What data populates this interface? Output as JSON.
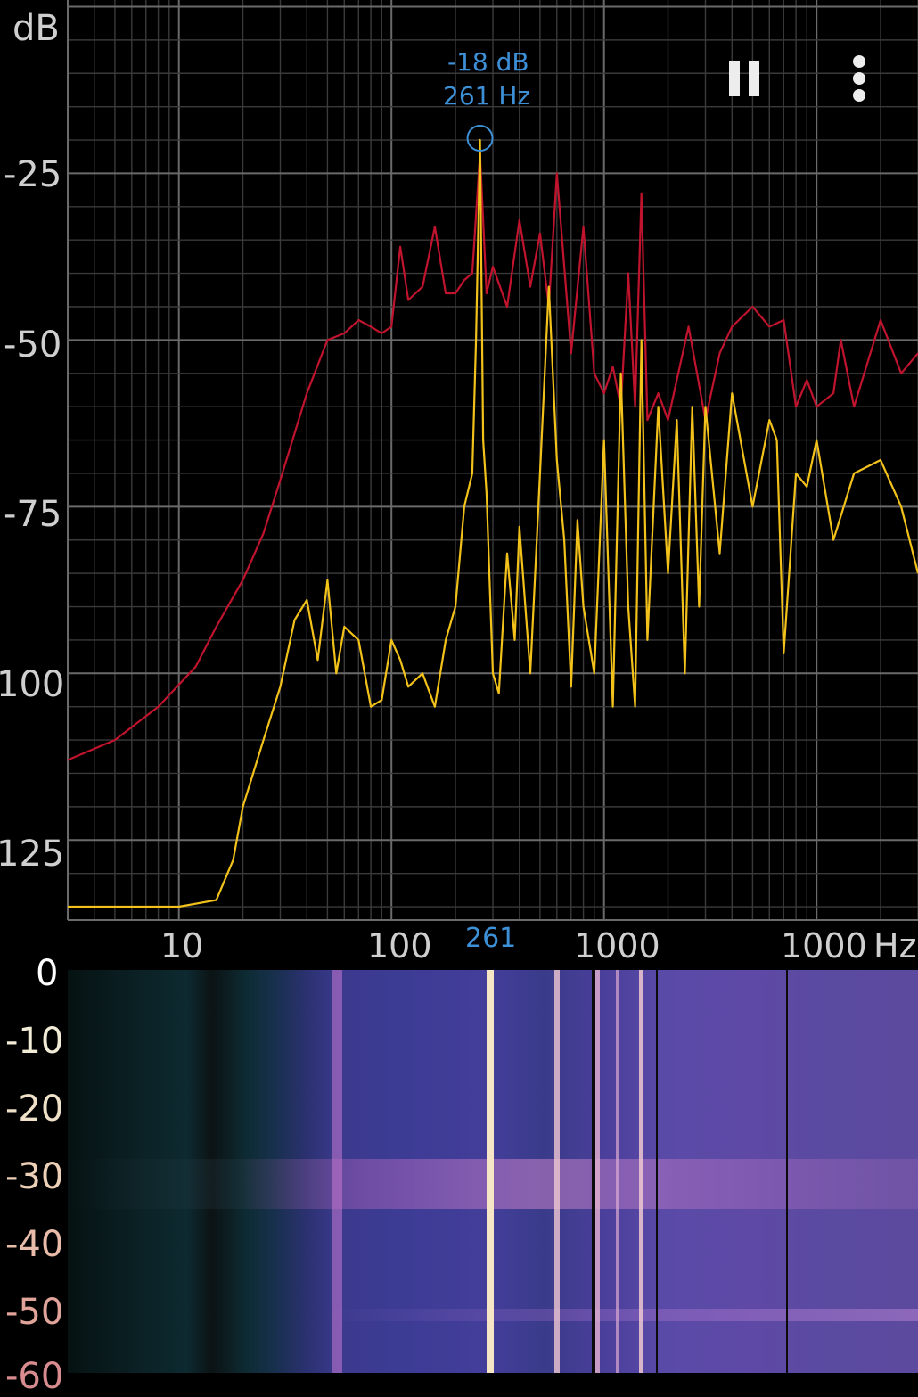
{
  "colors": {
    "background": "#000000",
    "grid": "#6a6a6a",
    "grid_minor": "#3a3a3a",
    "peak_hold": "#c0142e",
    "current": "#f2c21b",
    "peak_marker": "#3d8fd6",
    "axis_text": "#cfcfcf"
  },
  "toolbar": {
    "pause_icon": "pause-icon",
    "more_icon": "more-vertical-icon"
  },
  "spectrum": {
    "y_unit": "dB",
    "y_ticks": [
      "-25",
      "-50",
      "-75",
      "100",
      "125"
    ],
    "x_ticks": [
      "10",
      "100",
      "1000",
      "1000"
    ],
    "x_unit": "Hz",
    "x_marker_label": "261",
    "peak": {
      "level_label": "-18 dB",
      "freq_label": "261 Hz"
    }
  },
  "spectrogram": {
    "time_ticks": [
      "0",
      "-10",
      "-20",
      "-30",
      "-40",
      "-50",
      "-60"
    ],
    "time_tick_colors": [
      "#ffffff",
      "#f2ecd6",
      "#efe1c8",
      "#ecd0b8",
      "#e8bca8",
      "#e0a49a",
      "#d88c90"
    ]
  },
  "chart_data": {
    "type": "line",
    "x_scale": "log",
    "xlim": [
      3,
      30000
    ],
    "ylim": [
      -137,
      1
    ],
    "series": [
      {
        "x": [
          3,
          5,
          8,
          12,
          15,
          20,
          25,
          30,
          40,
          50,
          60,
          70,
          80,
          90,
          100,
          110,
          120,
          140,
          160,
          180,
          200,
          220,
          240,
          261,
          280,
          300,
          350,
          400,
          450,
          500,
          550,
          600,
          700,
          800,
          900,
          1000,
          1100,
          1200,
          1300,
          1400,
          1500,
          1600,
          1800,
          2000,
          2500,
          3000,
          3500,
          4000,
          5000,
          6000,
          7000,
          8000,
          9000,
          10000,
          12000,
          13000,
          15000,
          20000,
          25000,
          30000
        ],
        "y": [
          -113,
          -110,
          -105,
          -99,
          -93,
          -86,
          -79,
          -71,
          -58,
          -50,
          -49,
          -47,
          -48,
          -49,
          -48,
          -36,
          -44,
          -42,
          -33,
          -43,
          -43,
          -41,
          -40,
          -22,
          -43,
          -39,
          -45,
          -32,
          -42,
          -34,
          -45,
          -25,
          -52,
          -33,
          -55,
          -58,
          -54,
          -60,
          -40,
          -60,
          -28,
          -62,
          -58,
          -62,
          -48,
          -62,
          -52,
          -48,
          -45,
          -48,
          -47,
          -60,
          -56,
          -60,
          -58,
          -50,
          -60,
          -47,
          -55,
          -52
        ]
      },
      {
        "x": [
          3,
          10,
          15,
          18,
          20,
          25,
          30,
          35,
          40,
          45,
          50,
          55,
          60,
          70,
          80,
          90,
          100,
          110,
          120,
          140,
          160,
          180,
          200,
          220,
          240,
          250,
          261,
          270,
          280,
          300,
          320,
          350,
          380,
          400,
          450,
          500,
          550,
          600,
          650,
          700,
          750,
          800,
          900,
          1000,
          1100,
          1200,
          1300,
          1400,
          1500,
          1600,
          1800,
          2000,
          2200,
          2400,
          2600,
          2800,
          3000,
          3500,
          4000,
          5000,
          6000,
          6500,
          7000,
          8000,
          9000,
          10000,
          12000,
          15000,
          20000,
          25000,
          30000
        ],
        "y": [
          -135,
          -135,
          -134,
          -128,
          -120,
          -110,
          -102,
          -92,
          -89,
          -98,
          -86,
          -100,
          -93,
          -95,
          -105,
          -104,
          -95,
          -98,
          -102,
          -100,
          -105,
          -95,
          -90,
          -75,
          -70,
          -50,
          -20,
          -65,
          -73,
          -100,
          -103,
          -82,
          -95,
          -78,
          -100,
          -70,
          -42,
          -68,
          -80,
          -102,
          -77,
          -90,
          -100,
          -65,
          -105,
          -55,
          -90,
          -105,
          -50,
          -95,
          -60,
          -85,
          -62,
          -100,
          -60,
          -90,
          -60,
          -82,
          -58,
          -75,
          -62,
          -65,
          -97,
          -70,
          -72,
          -65,
          -80,
          -70,
          -68,
          -75,
          -85
        ]
      }
    ]
  }
}
